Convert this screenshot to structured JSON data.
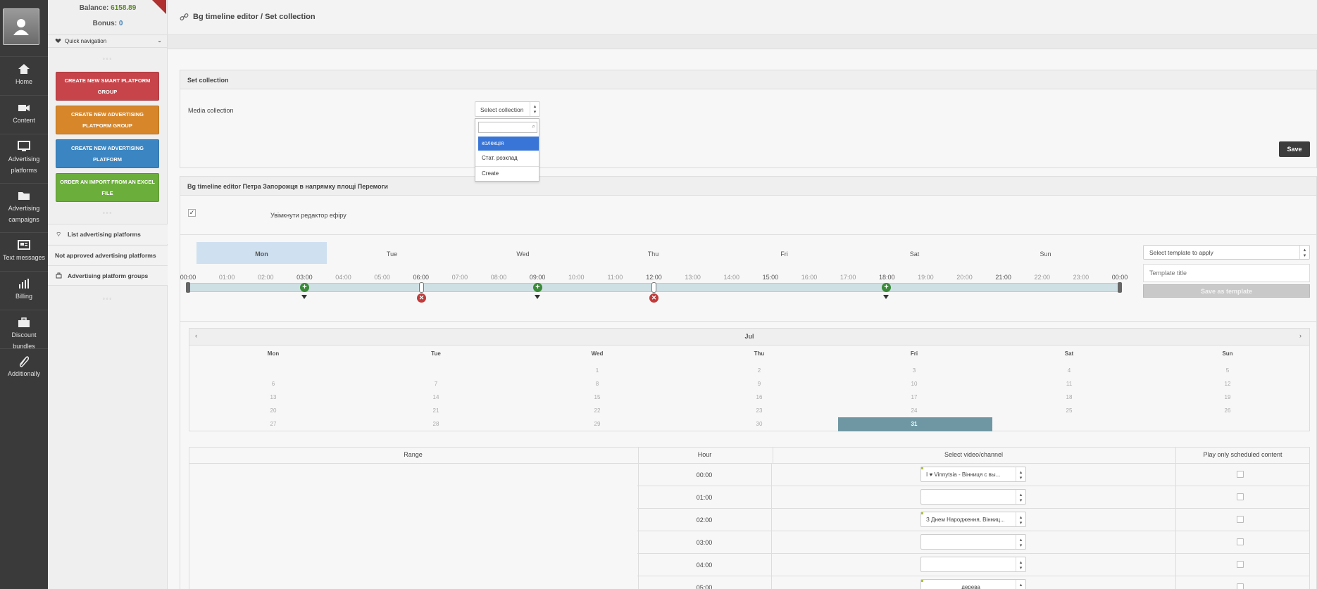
{
  "account": {
    "balance_label": "Balance:",
    "balance_value": "6158.89",
    "bonus_label": "Bonus:",
    "bonus_value": "0"
  },
  "nav": [
    {
      "label": "Home",
      "icon": "home-icon"
    },
    {
      "label": "Content",
      "icon": "video-camera-icon"
    },
    {
      "label": "Advertising platforms",
      "icon": "monitor-icon"
    },
    {
      "label": "Advertising campaigns",
      "icon": "folder-icon"
    },
    {
      "label": "Text messages",
      "icon": "news-icon"
    },
    {
      "label": "Billing",
      "icon": "bar-chart-icon"
    },
    {
      "label": "Discount bundles",
      "icon": "briefcase-icon"
    },
    {
      "label": "Additionally",
      "icon": "paperclip-icon"
    }
  ],
  "sidebar": {
    "quick_nav": "Quick navigation",
    "buttons": [
      {
        "label": "Create new smart platform group",
        "color": "#c7454a"
      },
      {
        "label": "Create new advertising platform group",
        "color": "#d7872a"
      },
      {
        "label": "Create new advertising platform",
        "color": "#3b86c2"
      },
      {
        "label": "Order an import from an excel file",
        "color": "#6cae3c"
      }
    ],
    "items": [
      {
        "label": "List advertising platforms"
      },
      {
        "label": "Not approved advertising platforms"
      },
      {
        "label": "Advertising platform groups"
      }
    ]
  },
  "header": {
    "breadcrumb": "Bg timeline editor / Set collection"
  },
  "set_collection": {
    "title": "Set collection",
    "field_label": "Media collection",
    "select_value": "Select collection",
    "options": [
      "колекція",
      "Стат. розклад",
      "Create"
    ],
    "save": "Save"
  },
  "editor": {
    "title": "Bg timeline editor Петра Запорожця в напрямку площі Перемоги",
    "enable_label": "Увімкнути редактор ефіру",
    "days": [
      "Mon",
      "Tue",
      "Wed",
      "Thu",
      "Fri",
      "Sat",
      "Sun"
    ],
    "hours": [
      "00:00",
      "01:00",
      "02:00",
      "03:00",
      "04:00",
      "05:00",
      "06:00",
      "07:00",
      "08:00",
      "09:00",
      "10:00",
      "11:00",
      "12:00",
      "13:00",
      "14:00",
      "15:00",
      "16:00",
      "17:00",
      "18:00",
      "19:00",
      "20:00",
      "21:00",
      "22:00",
      "23:00",
      "00:00"
    ],
    "template_select": "Select template to apply",
    "template_title_placeholder": "Template title",
    "save_template": "Save as template"
  },
  "calendar": {
    "month": "Jul",
    "weekdays": [
      "Mon",
      "Tue",
      "Wed",
      "Thu",
      "Fri",
      "Sat",
      "Sun"
    ],
    "weeks": [
      [
        "",
        "",
        "1",
        "2",
        "3",
        "4",
        "5"
      ],
      [
        "6",
        "7",
        "8",
        "9",
        "10",
        "11",
        "12"
      ],
      [
        "13",
        "14",
        "15",
        "16",
        "17",
        "18",
        "19"
      ],
      [
        "20",
        "21",
        "22",
        "23",
        "24",
        "25",
        "26"
      ],
      [
        "27",
        "28",
        "29",
        "30",
        "31",
        "",
        ""
      ]
    ],
    "selected": "31"
  },
  "schedule": {
    "headers": [
      "Range",
      "Hour",
      "Select video/channel",
      "Play only scheduled content"
    ],
    "rows": [
      {
        "hour": "00:00",
        "video": "I ♥ Vinnytsia - Вінниця с вы..."
      },
      {
        "hour": "01:00",
        "video": ""
      },
      {
        "hour": "02:00",
        "video": "З Днем Народження, Вінниц..."
      },
      {
        "hour": "03:00",
        "video": ""
      },
      {
        "hour": "04:00",
        "video": ""
      },
      {
        "hour": "05:00",
        "video": "дерева"
      }
    ]
  }
}
